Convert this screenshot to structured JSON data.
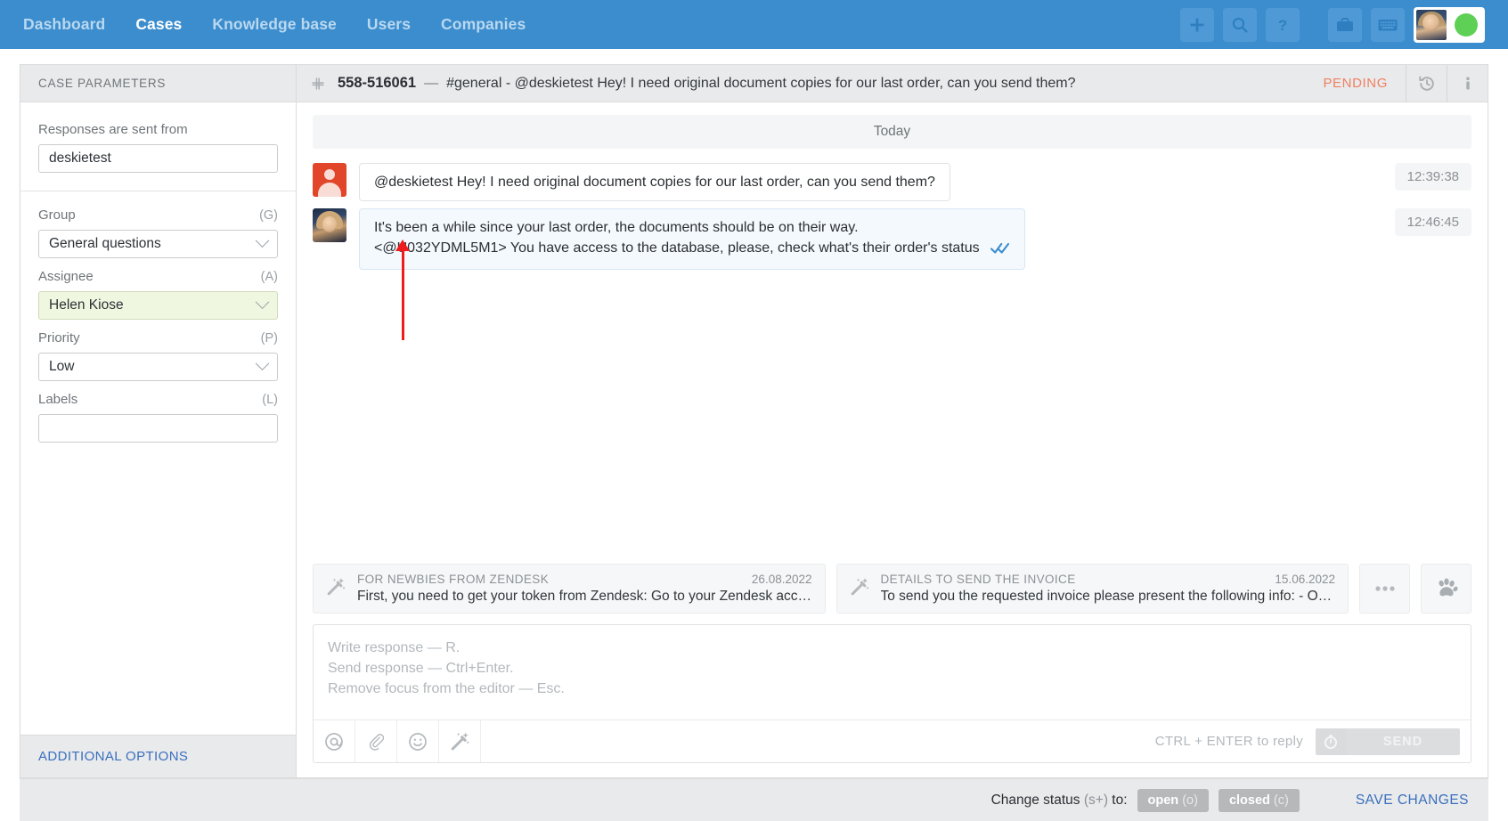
{
  "nav": {
    "links": [
      {
        "label": "Dashboard",
        "active": false
      },
      {
        "label": "Cases",
        "active": true
      },
      {
        "label": "Knowledge base",
        "active": false
      },
      {
        "label": "Users",
        "active": false
      },
      {
        "label": "Companies",
        "active": false
      }
    ],
    "actions": [
      {
        "name": "add-icon",
        "label": "+"
      },
      {
        "name": "search-icon",
        "label": "Search"
      },
      {
        "name": "help-icon",
        "label": "?"
      },
      {
        "name": "briefcase-icon",
        "label": "Briefcase"
      },
      {
        "name": "keyboard-icon",
        "label": "Keyboard"
      }
    ],
    "brand_color": "#3c8dcd",
    "status_color": "#5ed056"
  },
  "sidebar": {
    "header": "CASE PARAMETERS",
    "fields": [
      {
        "label": "Responses are sent from",
        "hint": "",
        "value": "deskietest",
        "type": "input",
        "highlight": false
      },
      {
        "label": "Group",
        "hint": "(G)",
        "value": "General questions",
        "type": "select",
        "highlight": false
      },
      {
        "label": "Assignee",
        "hint": "(A)",
        "value": "Helen Kiose",
        "type": "select",
        "highlight": true
      },
      {
        "label": "Priority",
        "hint": "(P)",
        "value": "Low",
        "type": "select",
        "highlight": false
      },
      {
        "label": "Labels",
        "hint": "(L)",
        "value": "",
        "type": "input",
        "highlight": false
      }
    ],
    "footer_link": "ADDITIONAL OPTIONS"
  },
  "case": {
    "channel_icon": "slack-icon",
    "id": "558-516061",
    "separator": "—",
    "title": "#general - @deskietest Hey! I need original document copies for our last order, can you send them?",
    "status": "PENDING",
    "status_color": "#f08060",
    "header_actions": [
      {
        "name": "history-icon",
        "label": "History"
      },
      {
        "name": "info-icon",
        "label": "Info"
      }
    ]
  },
  "chat": {
    "day_separator": "Today",
    "messages": [
      {
        "author_type": "client",
        "avatar": "client-avatar",
        "text": "@deskietest Hey! I need original document copies for our last order, can you send them?",
        "time": "12:39:38",
        "read_ticks": false
      },
      {
        "author_type": "agent",
        "avatar": "agent-avatar",
        "line1": "It's been a while since your last order, the documents should be on their way.",
        "line2": "<@U032YDML5M1> You have access to the database, please, check what's their order's status",
        "time": "12:46:45",
        "read_ticks": true
      }
    ],
    "annotation": {
      "type": "arrow",
      "color": "#ee1c1c"
    }
  },
  "macros": [
    {
      "icon": "magic-wand-icon",
      "title": "FOR NEWBIES FROM ZENDESK",
      "date": "26.08.2022",
      "text": "First, you need to get your token from Zendesk: Go to your Zendesk accou…"
    },
    {
      "icon": "magic-wand-icon",
      "title": "DETAILS TO SEND THE INVOICE",
      "date": "15.06.2022",
      "text": "To send you the requested invoice please present the following info: - Orga…"
    }
  ],
  "macro_buttons": [
    {
      "name": "more-options-icon",
      "label": "…"
    },
    {
      "name": "paw-icon",
      "label": "Paw"
    }
  ],
  "editor": {
    "placeholder_lines": [
      "Write response — R.",
      "Send response — Ctrl+Enter.",
      "Remove focus from the editor — Esc."
    ],
    "value": "",
    "tools": [
      {
        "name": "mention-icon",
        "label": "@"
      },
      {
        "name": "attachment-icon",
        "label": "Attach"
      },
      {
        "name": "emoji-icon",
        "label": "Emoji"
      },
      {
        "name": "magic-wand-icon",
        "label": "Macros"
      }
    ],
    "send_hint": "CTRL + ENTER to reply",
    "timer_icon": "timer-icon",
    "send_label": "SEND"
  },
  "bottombar": {
    "change_status_label": "Change status",
    "change_status_key": "(s+)",
    "change_status_suffix": "to:",
    "buttons": [
      {
        "label": "open",
        "key": "(o)"
      },
      {
        "label": "closed",
        "key": "(c)"
      }
    ],
    "save_label": "SAVE CHANGES"
  }
}
